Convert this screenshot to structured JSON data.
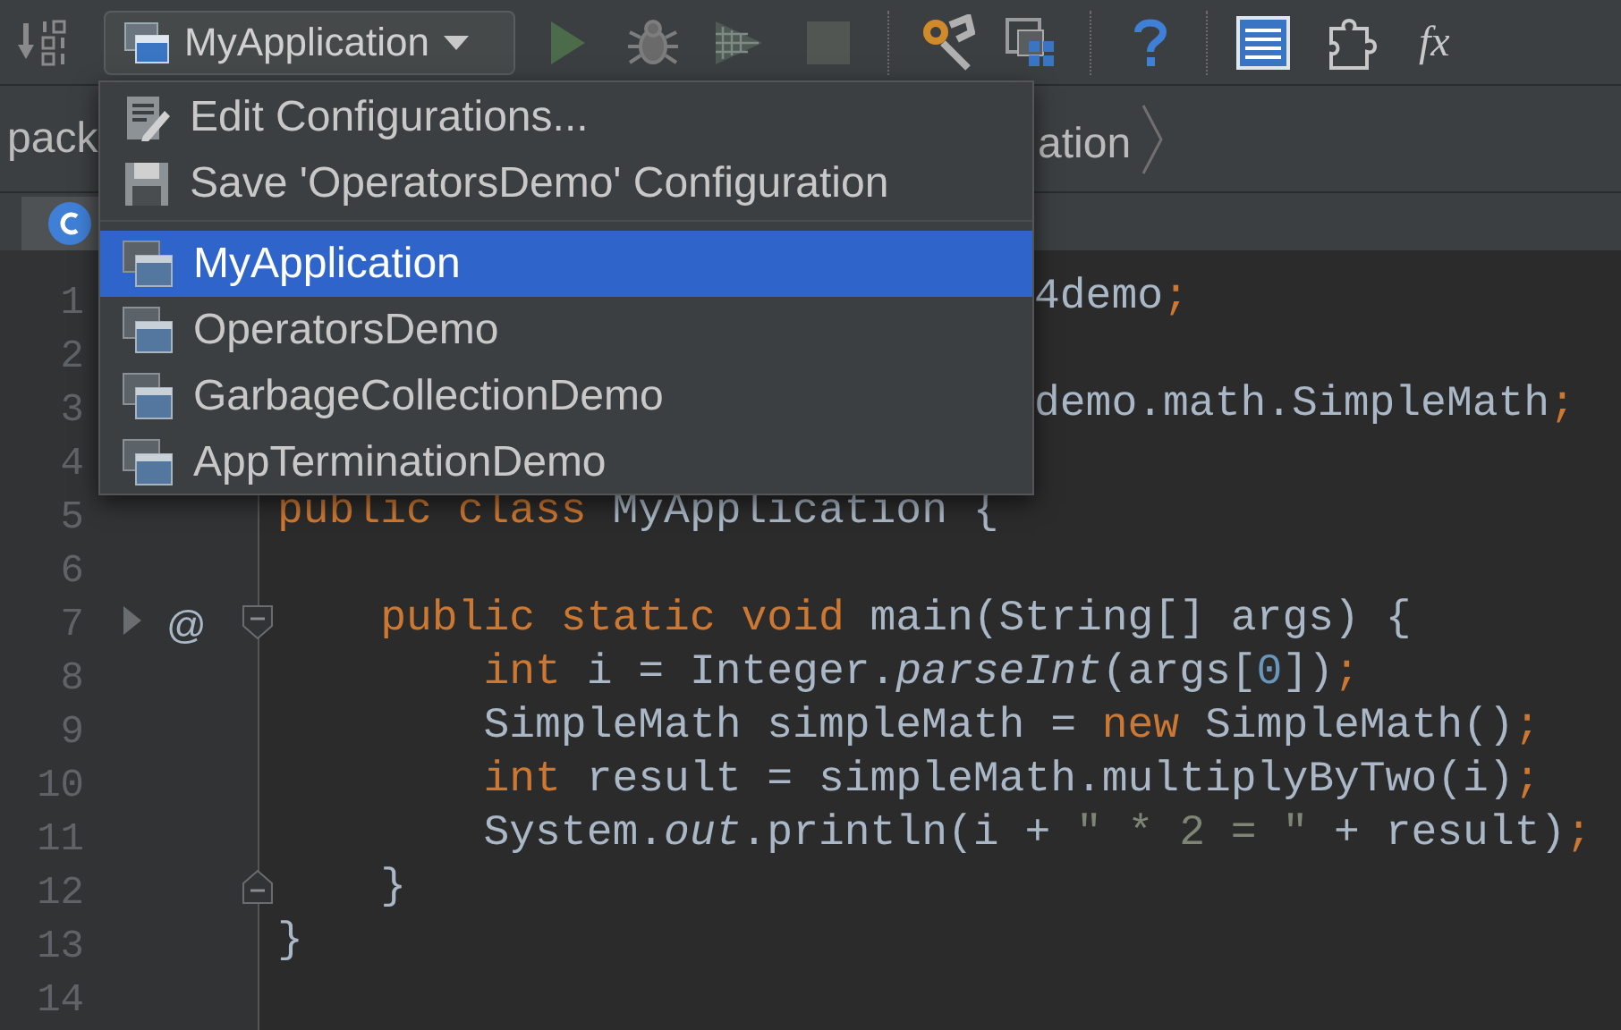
{
  "toolbar": {
    "run_config": {
      "label": "MyApplication"
    },
    "formula_label": "fx"
  },
  "breadcrumbs": [
    "pack",
    "ation"
  ],
  "menu": {
    "items": [
      {
        "kind": "edit",
        "label": "Edit Configurations...",
        "selected": false
      },
      {
        "kind": "save",
        "label": "Save 'OperatorsDemo' Configuration",
        "selected": false
      },
      {
        "kind": "config",
        "label": "MyApplication",
        "selected": true
      },
      {
        "kind": "config",
        "label": "OperatorsDemo",
        "selected": false
      },
      {
        "kind": "config",
        "label": "GarbageCollectionDemo",
        "selected": false
      },
      {
        "kind": "config",
        "label": "AppTerminationDemo",
        "selected": false
      }
    ]
  },
  "editor": {
    "lines": [
      {
        "number": "1",
        "kind": "partial",
        "tokens": [
          {
            "kind": "plain",
            "text": "4demo"
          },
          {
            "kind": "punct",
            "text": ";"
          }
        ]
      },
      {
        "number": "2"
      },
      {
        "number": "3",
        "kind": "partial",
        "tokens": [
          {
            "kind": "plain",
            "text": "demo.math.SimpleMath"
          },
          {
            "kind": "punct",
            "text": ";"
          }
        ]
      },
      {
        "number": "4"
      },
      {
        "number": "5",
        "tokens": [
          {
            "kind": "kw",
            "text": "public class "
          },
          {
            "kind": "plain",
            "text": "MyApplication {"
          }
        ]
      },
      {
        "number": "6"
      },
      {
        "number": "7",
        "gutter": [
          {
            "kind": "run"
          },
          {
            "kind": "override",
            "text": "@"
          },
          {
            "kind": "fold-start"
          }
        ],
        "tokens": [
          {
            "kind": "kw",
            "text": "    public static void "
          },
          {
            "kind": "plain",
            "text": "main(String[] args) {"
          }
        ]
      },
      {
        "number": "8",
        "tokens": [
          {
            "kind": "kw",
            "text": "        int "
          },
          {
            "kind": "plain",
            "text": "i = Integer."
          },
          {
            "kind": "italic",
            "text": "parseInt"
          },
          {
            "kind": "plain",
            "text": "(args["
          },
          {
            "kind": "num",
            "text": "0"
          },
          {
            "kind": "plain",
            "text": "])"
          },
          {
            "kind": "punct",
            "text": ";"
          }
        ]
      },
      {
        "number": "9",
        "tokens": [
          {
            "kind": "plain",
            "text": "        SimpleMath simpleMath = "
          },
          {
            "kind": "kw",
            "text": "new "
          },
          {
            "kind": "plain",
            "text": "SimpleMath()"
          },
          {
            "kind": "punct",
            "text": ";"
          }
        ]
      },
      {
        "number": "10",
        "tokens": [
          {
            "kind": "kw",
            "text": "        int "
          },
          {
            "kind": "plain",
            "text": "result = simpleMath.multiplyByTwo(i)"
          },
          {
            "kind": "punct",
            "text": ";"
          }
        ]
      },
      {
        "number": "11",
        "tokens": [
          {
            "kind": "plain",
            "text": "        System."
          },
          {
            "kind": "italic",
            "text": "out"
          },
          {
            "kind": "plain",
            "text": ".println(i + "
          },
          {
            "kind": "str",
            "text": "\" * 2 = \""
          },
          {
            "kind": "plain",
            "text": " + result)"
          },
          {
            "kind": "punct",
            "text": ";"
          }
        ]
      },
      {
        "number": "12",
        "gutter": [
          {
            "kind": "fold-end"
          }
        ],
        "tokens": [
          {
            "kind": "plain",
            "text": "    }"
          }
        ]
      },
      {
        "number": "13",
        "tokens": [
          {
            "kind": "plain",
            "text": "}"
          }
        ]
      },
      {
        "number": "14"
      }
    ]
  }
}
